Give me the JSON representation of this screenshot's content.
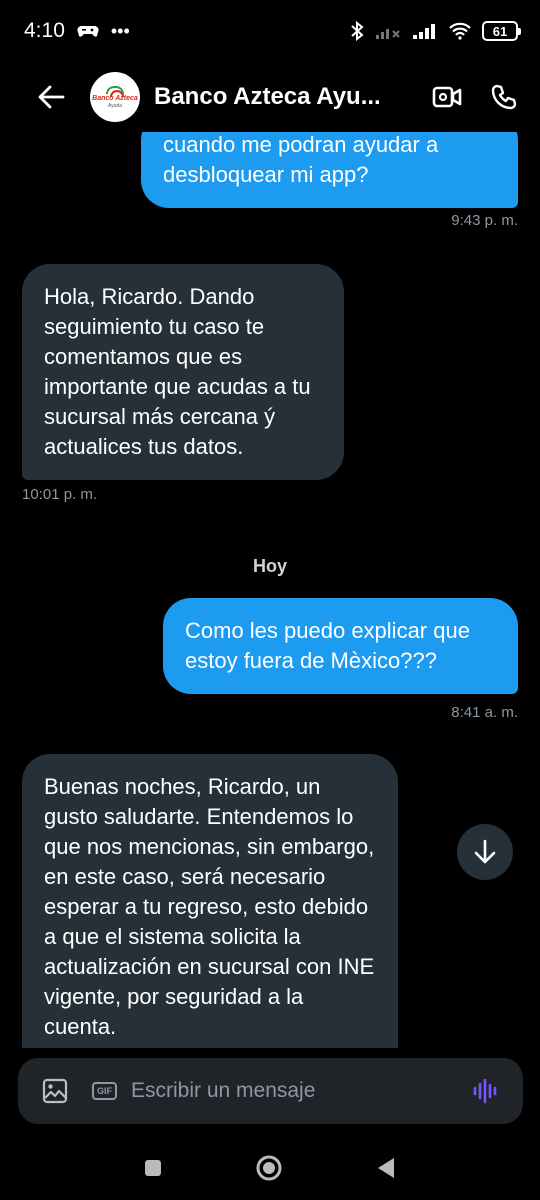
{
  "status_bar": {
    "time": "4:10",
    "battery": "61"
  },
  "header": {
    "title": "Banco Azteca Ayu...",
    "avatar_logo": "Banco Azteca",
    "avatar_sub": "Ayuda"
  },
  "messages": [
    {
      "text": "cuando me podran ayudar a desbloquear mi app?",
      "time": "9:43 p. m."
    },
    {
      "text": "Hola, Ricardo. Dando seguimiento tu caso te comentamos que es importante que acudas a tu sucursal más cercana ý actualices tus datos.",
      "time": "10:01 p. m."
    },
    {
      "day": "Hoy"
    },
    {
      "text": "Como les puedo explicar que estoy fuera de Mèxico???",
      "time": "8:41 a. m."
    },
    {
      "text": "Buenas noches, Ricardo, un gusto saludarte. Entendemos lo que nos mencionas, sin embargo, en este caso, será necesario esperar a tu regreso, esto debido a que el sistema solicita la actualización en sucursal con INE vigente, por seguridad a la cuenta."
    }
  ],
  "composer": {
    "placeholder": "Escribir un mensaje",
    "gif_label": "GIF"
  },
  "colors": {
    "outgoing": "#1d9bf0",
    "incoming": "#253038",
    "voice_accent": "#7856ff"
  }
}
